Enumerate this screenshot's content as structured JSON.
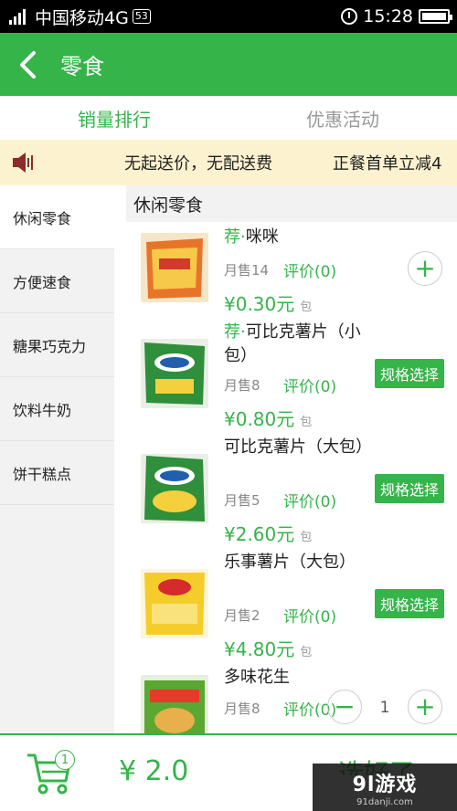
{
  "status_bar": {
    "signal_label": "4G",
    "carrier": "中国移动4G",
    "badge": "53",
    "time": "15:28"
  },
  "header": {
    "title": "零食"
  },
  "tabs": [
    {
      "label": "销量排行",
      "active": true
    },
    {
      "label": "优惠活动",
      "active": false
    }
  ],
  "notice": {
    "text": "无起送价，无配送费",
    "text2": "正餐首单立减4"
  },
  "sidebar": {
    "items": [
      {
        "label": "休闲零食",
        "active": true
      },
      {
        "label": "方便速食",
        "active": false
      },
      {
        "label": "糖果巧克力",
        "active": false
      },
      {
        "label": "饮料牛奶",
        "active": false
      },
      {
        "label": "饼干糕点",
        "active": false
      }
    ]
  },
  "category": {
    "title": "休闲零食"
  },
  "products": [
    {
      "rec": "荐·",
      "name": "咪咪",
      "sold": "月售14",
      "rating": "评价(0)",
      "price": "¥0.30元",
      "unit": "包",
      "action": "+"
    },
    {
      "rec": "荐·",
      "name": "可比克薯片（小包）",
      "sold": "月售8",
      "rating": "评价(0)",
      "price": "¥0.80元",
      "unit": "包",
      "action": "规格选择"
    },
    {
      "rec": "",
      "name": "可比克薯片（大包）",
      "sold": "月售5",
      "rating": "评价(0)",
      "price": "¥2.60元",
      "unit": "包",
      "action": "规格选择"
    },
    {
      "rec": "",
      "name": "乐事薯片（大包）",
      "sold": "月售2",
      "rating": "评价(0)",
      "price": "¥4.80元",
      "unit": "包",
      "action": "规格选择"
    },
    {
      "rec": "",
      "name": "多味花生",
      "sold": "月售8",
      "rating": "评价(0)",
      "price": "",
      "unit": "",
      "minus": "−",
      "qty": "1",
      "plus": "+"
    }
  ],
  "footer": {
    "cart_count": "1",
    "total": "¥ 2.0",
    "checkout": "选好了"
  },
  "watermark": {
    "big": "9l游戏",
    "small": "91danji.com"
  },
  "colors": {
    "accent": "#35b44a",
    "notice_bg": "#fdf2cf",
    "sidebar_bg": "#f2f2f2"
  }
}
